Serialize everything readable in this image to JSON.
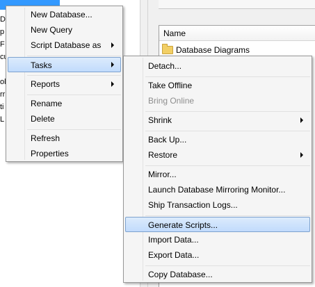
{
  "background": {
    "tree_fragments": [
      "D",
      "p",
      "F",
      "cu",
      "ol",
      "rr",
      "ti",
      "L"
    ],
    "detail_header": "Name",
    "detail_rows": [
      {
        "label": "Database Diagrams",
        "icon": "folder-icon"
      }
    ]
  },
  "context_menu": {
    "items": [
      {
        "label": "New Database...",
        "submenu": false
      },
      {
        "label": "New Query",
        "submenu": false
      },
      {
        "label": "Script Database as",
        "submenu": true
      },
      {
        "label": "Tasks",
        "submenu": true,
        "highlighted": true
      },
      {
        "label": "Reports",
        "submenu": true
      },
      {
        "label": "Rename",
        "submenu": false
      },
      {
        "label": "Delete",
        "submenu": false
      },
      {
        "label": "Refresh",
        "submenu": false
      },
      {
        "label": "Properties",
        "submenu": false
      }
    ]
  },
  "tasks_menu": {
    "items": [
      {
        "label": "Detach...",
        "submenu": false
      },
      {
        "label": "Take Offline",
        "submenu": false
      },
      {
        "label": "Bring Online",
        "submenu": false,
        "disabled": true
      },
      {
        "label": "Shrink",
        "submenu": true
      },
      {
        "label": "Back Up...",
        "submenu": false
      },
      {
        "label": "Restore",
        "submenu": true
      },
      {
        "label": "Mirror...",
        "submenu": false
      },
      {
        "label": "Launch Database Mirroring Monitor...",
        "submenu": false
      },
      {
        "label": "Ship Transaction Logs...",
        "submenu": false
      },
      {
        "label": "Generate Scripts...",
        "submenu": false,
        "highlighted": true
      },
      {
        "label": "Import Data...",
        "submenu": false
      },
      {
        "label": "Export Data...",
        "submenu": false
      },
      {
        "label": "Copy Database...",
        "submenu": false
      }
    ]
  },
  "colors": {
    "highlight_top": "#dcebfc",
    "highlight_bottom": "#c1dbfc",
    "highlight_border": "#7da2ce",
    "menu_background": "#f5f5f5",
    "selection_blue": "#3399ff",
    "disabled_text": "#8e8e8e"
  }
}
